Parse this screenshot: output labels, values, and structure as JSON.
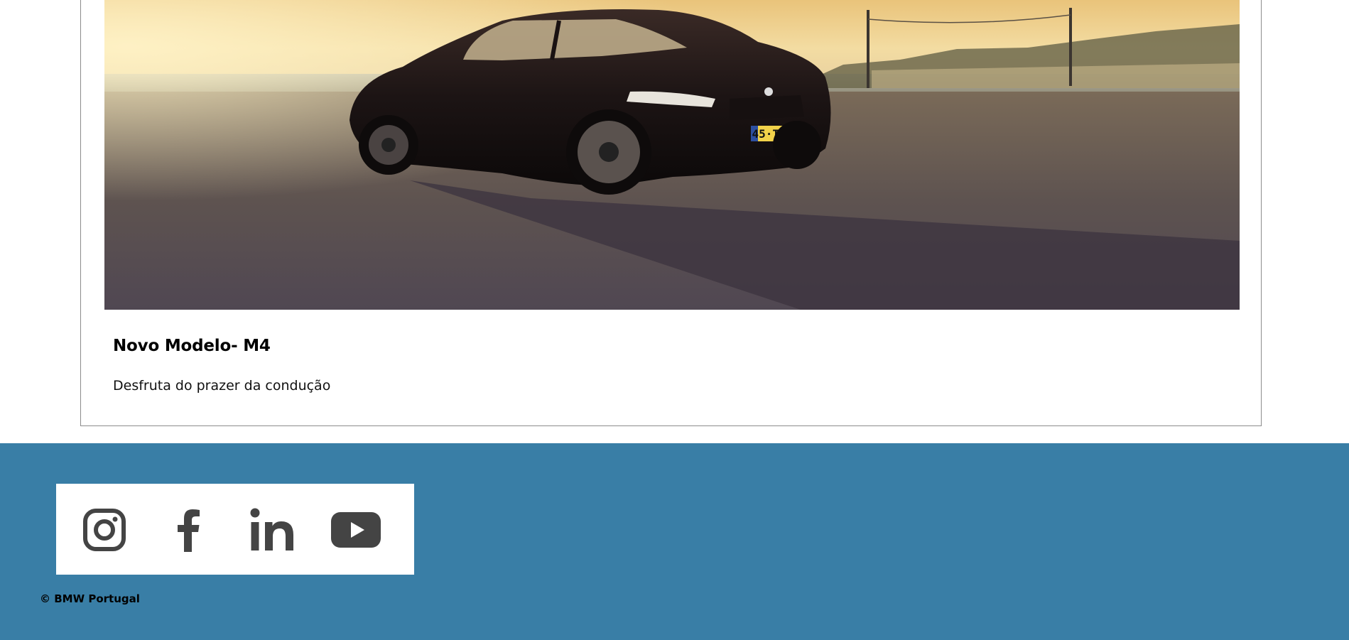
{
  "card": {
    "image_alt": "BMW M4 preto estacionado ao pôr do sol",
    "title": "Novo Modelo- M4",
    "subtitle": "Desfruta do prazer da condução",
    "plate_text": "45·TU·54"
  },
  "footer": {
    "social": [
      {
        "icon": "instagram-icon"
      },
      {
        "icon": "facebook-icon"
      },
      {
        "icon": "linkedin-icon"
      },
      {
        "icon": "youtube-icon"
      }
    ],
    "copyright": "© BMW Portugal"
  },
  "colors": {
    "footer_bg": "#397ea6",
    "icon": "#444444"
  }
}
